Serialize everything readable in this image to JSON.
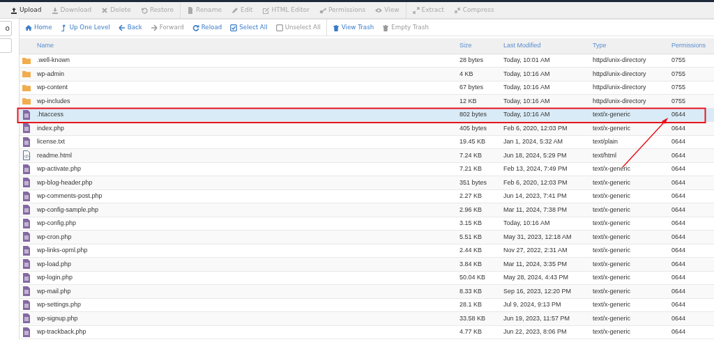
{
  "toolbar": [
    [
      {
        "label": "Upload",
        "disabled": false
      },
      {
        "label": "Download",
        "disabled": true
      },
      {
        "label": "Delete",
        "disabled": true
      },
      {
        "label": "Restore",
        "disabled": true
      }
    ],
    [
      {
        "label": "Rename",
        "disabled": true
      },
      {
        "label": "Edit",
        "disabled": true
      },
      {
        "label": "HTML Editor",
        "disabled": true
      },
      {
        "label": "Permissions",
        "disabled": true
      },
      {
        "label": "View",
        "disabled": true
      }
    ],
    [
      {
        "label": "Extract",
        "disabled": true
      },
      {
        "label": "Compress",
        "disabled": true
      }
    ]
  ],
  "sidebar": {
    "go_button": "o"
  },
  "nav": [
    [
      {
        "label": "Home",
        "disabled": false
      },
      {
        "label": "Up One Level",
        "disabled": false
      },
      {
        "label": "Back",
        "disabled": false
      },
      {
        "label": "Forward",
        "disabled": true
      },
      {
        "label": "Reload",
        "disabled": false
      },
      {
        "label": "Select All",
        "disabled": false
      },
      {
        "label": "Unselect All",
        "disabled": true
      }
    ],
    [
      {
        "label": "View Trash",
        "disabled": false
      },
      {
        "label": "Empty Trash",
        "disabled": true
      }
    ]
  ],
  "table": {
    "columns": [
      "Name",
      "Size",
      "Last Modified",
      "Type",
      "Permissions"
    ],
    "rows": [
      {
        "kind": "folder",
        "name": ".well-known",
        "size": "28 bytes",
        "modified": "Today, 10:01 AM",
        "type": "httpd/unix-directory",
        "permissions": "0755",
        "selected": false
      },
      {
        "kind": "folder",
        "name": "wp-admin",
        "size": "4 KB",
        "modified": "Today, 10:16 AM",
        "type": "httpd/unix-directory",
        "permissions": "0755",
        "selected": false
      },
      {
        "kind": "folder",
        "name": "wp-content",
        "size": "67 bytes",
        "modified": "Today, 10:16 AM",
        "type": "httpd/unix-directory",
        "permissions": "0755",
        "selected": false
      },
      {
        "kind": "folder",
        "name": "wp-includes",
        "size": "12 KB",
        "modified": "Today, 10:16 AM",
        "type": "httpd/unix-directory",
        "permissions": "0755",
        "selected": false
      },
      {
        "kind": "file",
        "name": ".htaccess",
        "size": "802 bytes",
        "modified": "Today, 10:16 AM",
        "type": "text/x-generic",
        "permissions": "0644",
        "selected": true
      },
      {
        "kind": "file",
        "name": "index.php",
        "size": "405 bytes",
        "modified": "Feb 6, 2020, 12:03 PM",
        "type": "text/x-generic",
        "permissions": "0644",
        "selected": false
      },
      {
        "kind": "file",
        "name": "license.txt",
        "size": "19.45 KB",
        "modified": "Jan 1, 2024, 5:32 AM",
        "type": "text/plain",
        "permissions": "0644",
        "selected": false
      },
      {
        "kind": "code",
        "name": "readme.html",
        "size": "7.24 KB",
        "modified": "Jun 18, 2024, 5:29 PM",
        "type": "text/html",
        "permissions": "0644",
        "selected": false
      },
      {
        "kind": "file",
        "name": "wp-activate.php",
        "size": "7.21 KB",
        "modified": "Feb 13, 2024, 7:49 PM",
        "type": "text/x-generic",
        "permissions": "0644",
        "selected": false
      },
      {
        "kind": "file",
        "name": "wp-blog-header.php",
        "size": "351 bytes",
        "modified": "Feb 6, 2020, 12:03 PM",
        "type": "text/x-generic",
        "permissions": "0644",
        "selected": false
      },
      {
        "kind": "file",
        "name": "wp-comments-post.php",
        "size": "2.27 KB",
        "modified": "Jun 14, 2023, 7:41 PM",
        "type": "text/x-generic",
        "permissions": "0644",
        "selected": false
      },
      {
        "kind": "file",
        "name": "wp-config-sample.php",
        "size": "2.96 KB",
        "modified": "Mar 11, 2024, 7:38 PM",
        "type": "text/x-generic",
        "permissions": "0644",
        "selected": false
      },
      {
        "kind": "file",
        "name": "wp-config.php",
        "size": "3.15 KB",
        "modified": "Today, 10:16 AM",
        "type": "text/x-generic",
        "permissions": "0644",
        "selected": false
      },
      {
        "kind": "file",
        "name": "wp-cron.php",
        "size": "5.51 KB",
        "modified": "May 31, 2023, 12:18 AM",
        "type": "text/x-generic",
        "permissions": "0644",
        "selected": false
      },
      {
        "kind": "file",
        "name": "wp-links-opml.php",
        "size": "2.44 KB",
        "modified": "Nov 27, 2022, 2:31 AM",
        "type": "text/x-generic",
        "permissions": "0644",
        "selected": false
      },
      {
        "kind": "file",
        "name": "wp-load.php",
        "size": "3.84 KB",
        "modified": "Mar 11, 2024, 3:35 PM",
        "type": "text/x-generic",
        "permissions": "0644",
        "selected": false
      },
      {
        "kind": "file",
        "name": "wp-login.php",
        "size": "50.04 KB",
        "modified": "May 28, 2024, 4:43 PM",
        "type": "text/x-generic",
        "permissions": "0644",
        "selected": false
      },
      {
        "kind": "file",
        "name": "wp-mail.php",
        "size": "8.33 KB",
        "modified": "Sep 16, 2023, 12:20 PM",
        "type": "text/x-generic",
        "permissions": "0644",
        "selected": false
      },
      {
        "kind": "file",
        "name": "wp-settings.php",
        "size": "28.1 KB",
        "modified": "Jul 9, 2024, 9:13 PM",
        "type": "text/x-generic",
        "permissions": "0644",
        "selected": false
      },
      {
        "kind": "file",
        "name": "wp-signup.php",
        "size": "33.58 KB",
        "modified": "Jun 19, 2023, 11:57 PM",
        "type": "text/x-generic",
        "permissions": "0644",
        "selected": false
      },
      {
        "kind": "file",
        "name": "wp-trackback.php",
        "size": "4.77 KB",
        "modified": "Jun 22, 2023, 8:06 PM",
        "type": "text/x-generic",
        "permissions": "0644",
        "selected": false
      }
    ]
  }
}
